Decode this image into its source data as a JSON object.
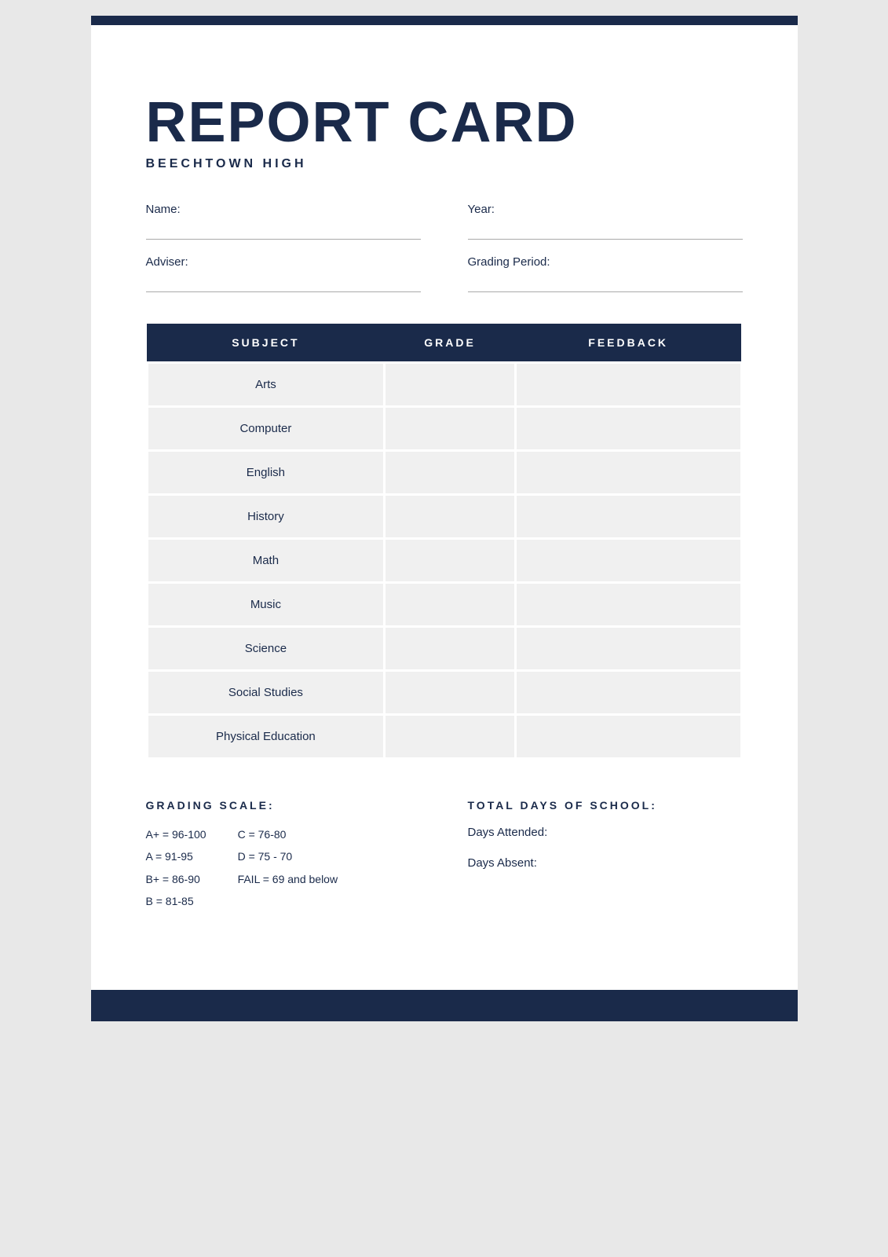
{
  "header": {
    "title": "REPORT CARD",
    "school": "BEECHTOWN HIGH"
  },
  "form": {
    "name_label": "Name:",
    "year_label": "Year:",
    "adviser_label": "Adviser:",
    "grading_period_label": "Grading Period:"
  },
  "table": {
    "headers": [
      "SUBJECT",
      "GRADE",
      "FEEDBACK"
    ],
    "rows": [
      {
        "subject": "Arts",
        "grade": "",
        "feedback": ""
      },
      {
        "subject": "Computer",
        "grade": "",
        "feedback": ""
      },
      {
        "subject": "English",
        "grade": "",
        "feedback": ""
      },
      {
        "subject": "History",
        "grade": "",
        "feedback": ""
      },
      {
        "subject": "Math",
        "grade": "",
        "feedback": ""
      },
      {
        "subject": "Music",
        "grade": "",
        "feedback": ""
      },
      {
        "subject": "Science",
        "grade": "",
        "feedback": ""
      },
      {
        "subject": "Social Studies",
        "grade": "",
        "feedback": ""
      },
      {
        "subject": "Physical Education",
        "grade": "",
        "feedback": ""
      }
    ]
  },
  "grading_scale": {
    "title": "GRADING SCALE:",
    "left_col": [
      "A+ = 96-100",
      "A = 91-95",
      "B+ = 86-90",
      "B = 81-85"
    ],
    "right_col": [
      "C = 76-80",
      "D = 75 - 70",
      "FAIL = 69 and below"
    ]
  },
  "total_days": {
    "title": "TOTAL DAYS OF SCHOOL:",
    "days_attended_label": "Days Attended:",
    "days_absent_label": "Days Absent:"
  }
}
